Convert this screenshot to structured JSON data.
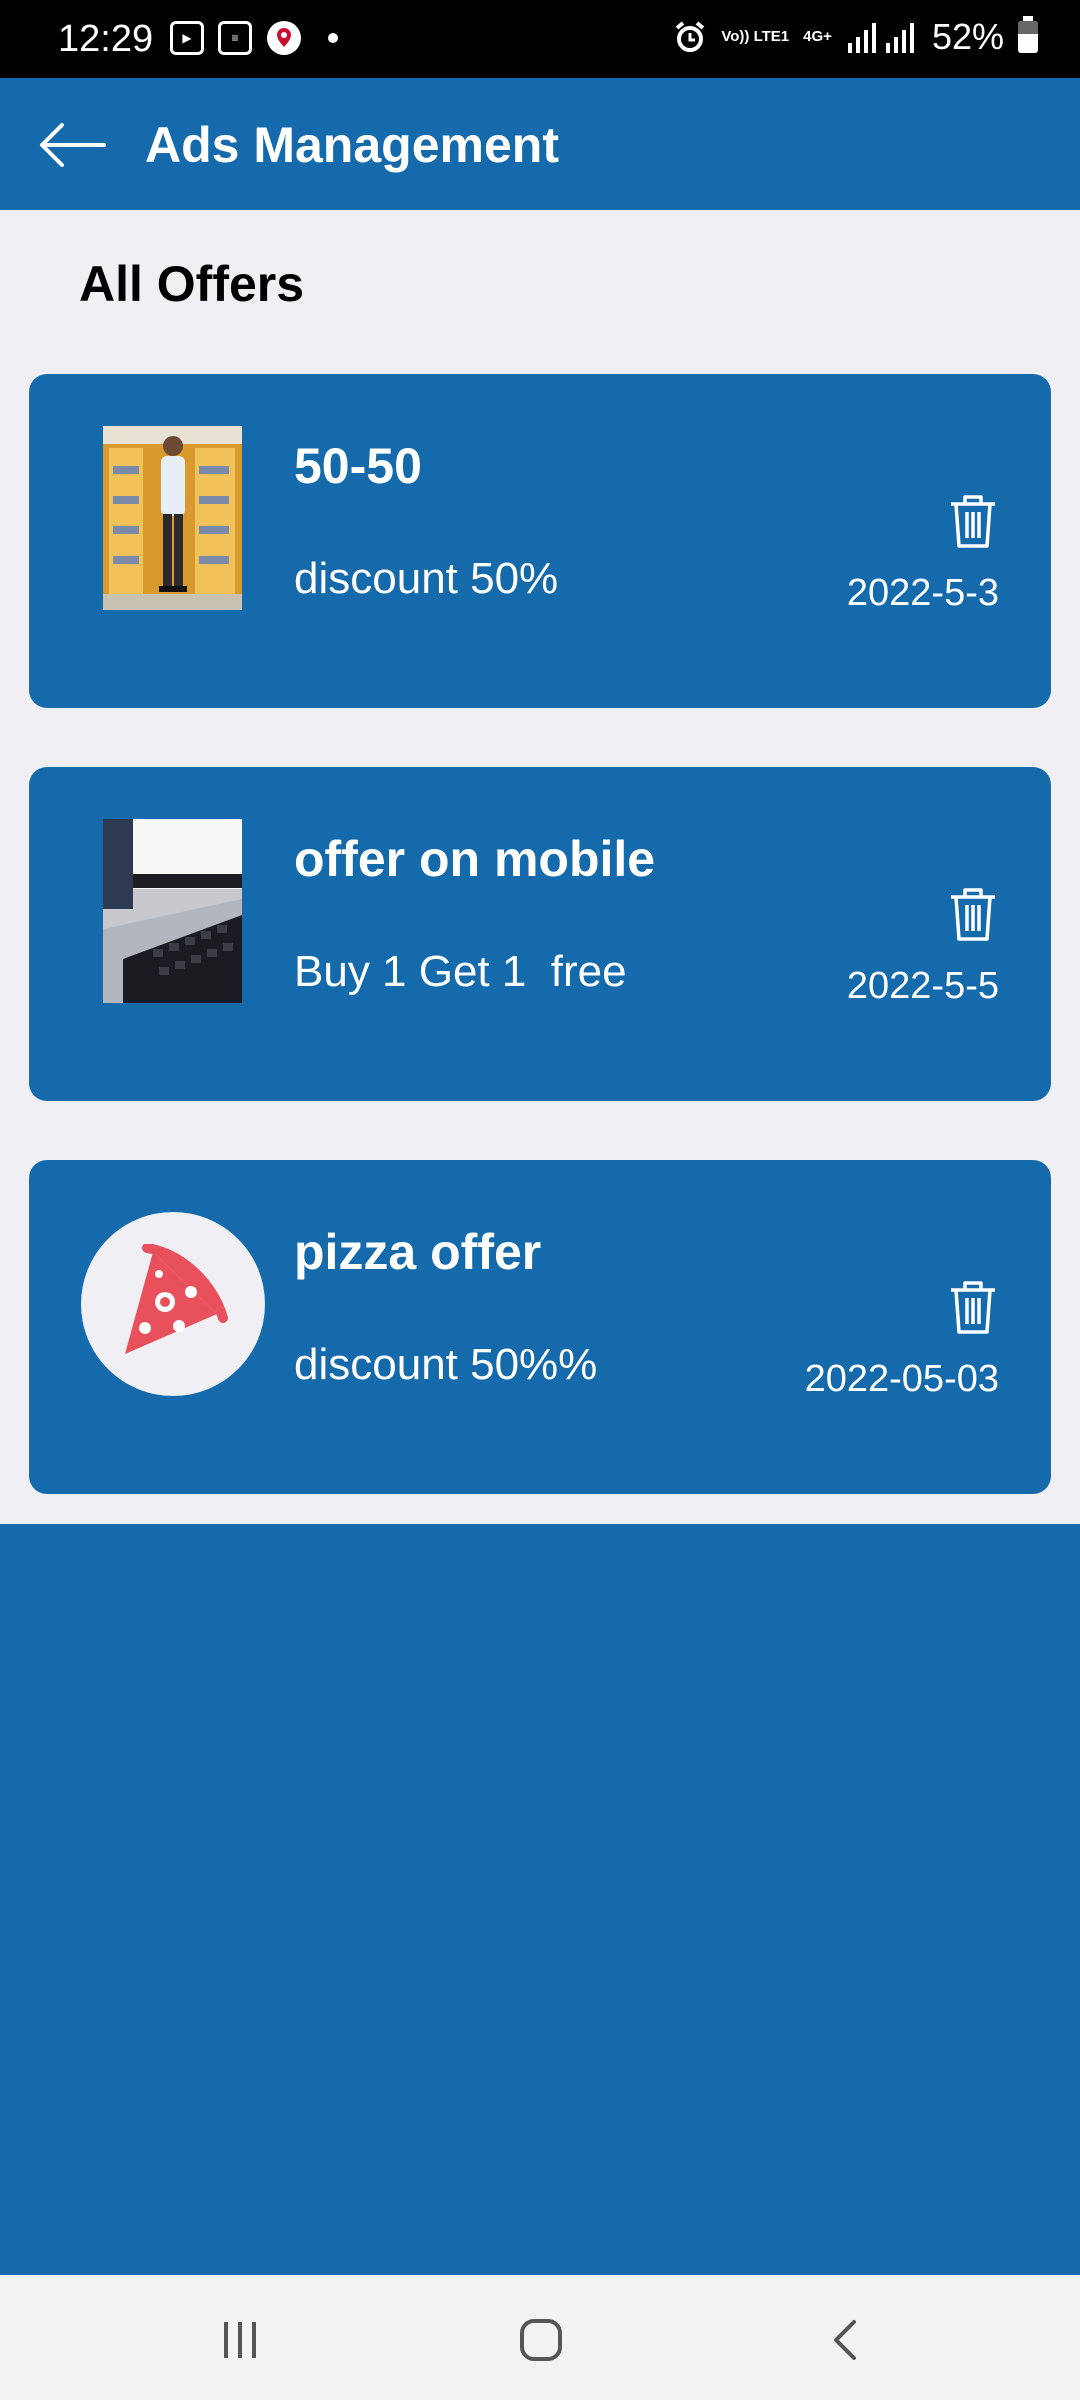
{
  "status_bar": {
    "time": "12:29",
    "network_label": "Vo)) LTE1",
    "data_label": "4G+",
    "battery": "52%"
  },
  "app_bar": {
    "title": "Ads Management",
    "back_icon": "arrow-left-icon"
  },
  "section": {
    "title": "All Offers"
  },
  "offers": [
    {
      "title": "50-50",
      "description": "discount 50%",
      "date": "2022-5-3",
      "thumbnail": "photo-person-store",
      "delete_icon": "trash-icon"
    },
    {
      "title": "offer on mobile",
      "description": "Buy 1 Get 1  free",
      "date": "2022-5-5",
      "thumbnail": "photo-keyboard-desk",
      "delete_icon": "trash-icon"
    },
    {
      "title": "pizza offer",
      "description": "discount 50%%",
      "date": "2022-05-03",
      "thumbnail": "pizza-icon",
      "delete_icon": "trash-icon"
    }
  ],
  "navigation": {
    "recents_icon": "recents-icon",
    "home_icon": "home-icon",
    "back_icon": "back-chevron-icon"
  },
  "colors": {
    "primary": "#156aab",
    "background": "#efeff4",
    "pizza_accent": "#e8505b"
  }
}
